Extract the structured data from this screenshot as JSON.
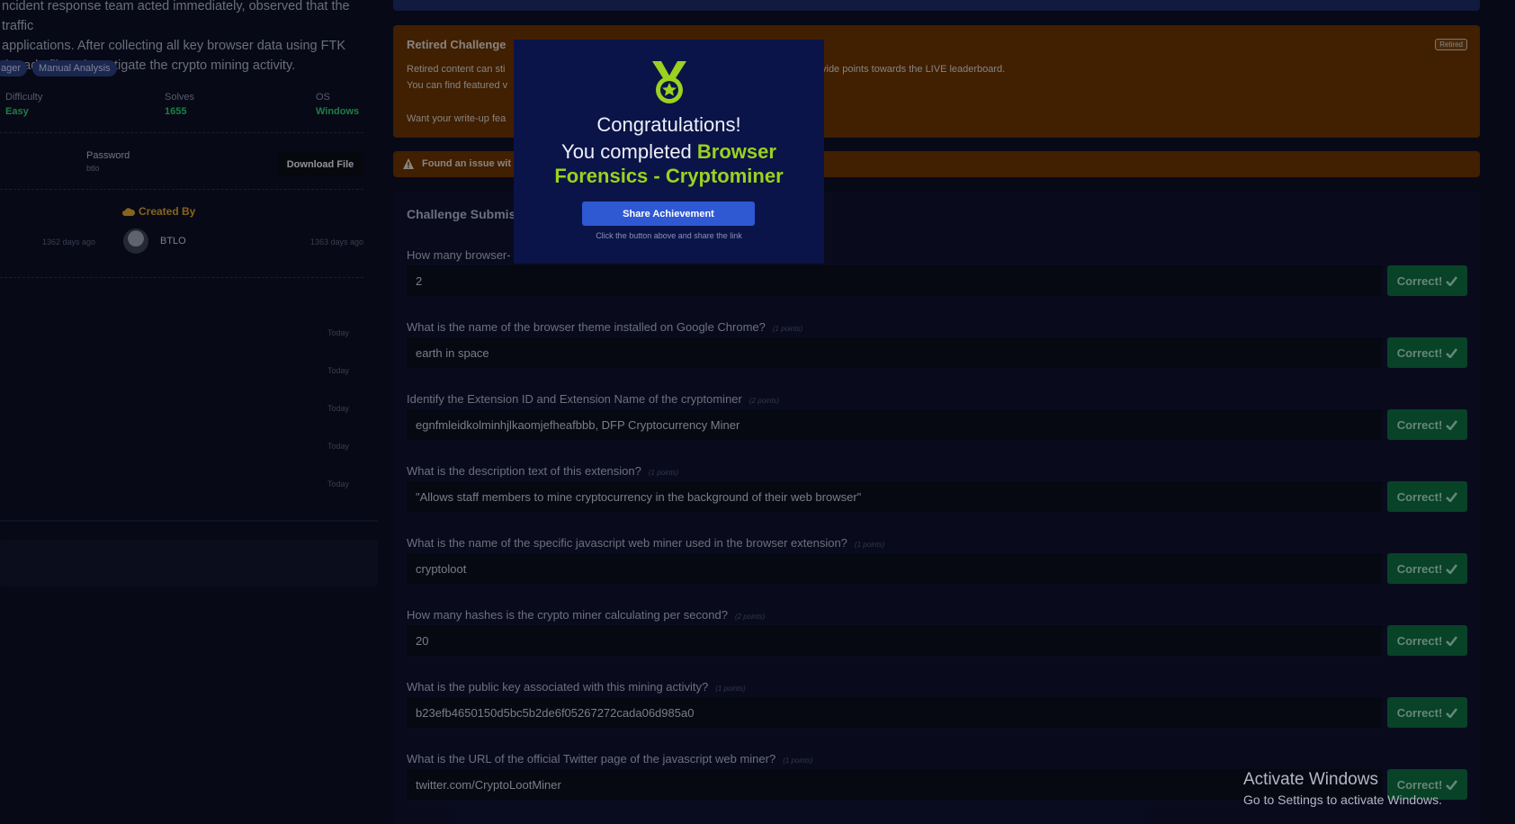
{
  "left": {
    "description_lines": [
      "ncident response team acted immediately, observed that the traffic",
      " applications. After collecting all key browser data using FTK",
      " the ad1 file to investigate the crypto mining activity."
    ],
    "tags": [
      "ager",
      "Manual Analysis"
    ],
    "stats": [
      {
        "label": "Difficulty",
        "value": "Easy"
      },
      {
        "label": "Solves",
        "value": "1655"
      },
      {
        "label": "OS",
        "value": "Windows"
      }
    ],
    "password_label": "Password",
    "password_value": "btlo",
    "download_label": "Download File",
    "created_by_label": "Created By",
    "created_left_ago": "1362 days ago",
    "author": "BTLO",
    "created_right_ago": "1363 days ago",
    "today_labels": [
      "Today",
      "Today",
      "Today",
      "Today",
      "Today"
    ]
  },
  "retired": {
    "title": "Retired Challenge",
    "badge": "Retired",
    "line1_left": "Retired content can sti",
    "line1_right": "vide points towards the LIVE leaderboard.",
    "line2": "You can find featured v",
    "line3": "Want your write-up fea"
  },
  "issue": {
    "text": "Found an issue wit"
  },
  "submission": {
    "title": "Challenge Submis",
    "questions": [
      {
        "q": "How many browser-",
        "pts": "",
        "answer": "2"
      },
      {
        "q": "What is the name of the browser theme installed on Google Chrome?",
        "pts": "(1 points)",
        "answer": "earth in space"
      },
      {
        "q": "Identify the Extension ID and Extension Name of the cryptominer",
        "pts": "(2 points)",
        "answer": "egnfmleidkolminhjlkaomjefheafbbb,  DFP Cryptocurrency Miner"
      },
      {
        "q": "What is the description text of this extension?",
        "pts": "(1 points)",
        "answer": "\"Allows staff members to mine cryptocurrency in the background of their web browser\""
      },
      {
        "q": "What is the name of the specific javascript web miner used in the browser extension?",
        "pts": "(1 points)",
        "answer": "cryptoloot"
      },
      {
        "q": "How many hashes is the crypto miner calculating per second?",
        "pts": "(2 points)",
        "answer": "20"
      },
      {
        "q": "What is the public key associated with this mining activity?",
        "pts": "(1 points)",
        "answer": "b23efb4650150d5bc5b2de6f05267272cada06d985a0"
      },
      {
        "q": "What is the URL of the official Twitter page of the javascript web miner?",
        "pts": "(1 points)",
        "answer": "twitter.com/CryptoLootMiner"
      }
    ],
    "correct_label": "Correct!"
  },
  "modal": {
    "congrats": "Congratulations!",
    "completed_prefix": "You completed ",
    "challenge_name_1": "Browser",
    "challenge_name_2": "Forensics - Cryptominer",
    "share_button": "Share Achievement",
    "share_hint": "Click the button above and share the link"
  },
  "windows": {
    "activate_title": "Activate Windows",
    "activate_sub": "Go to Settings to activate Windows."
  },
  "colors": {
    "accent_green": "#9ad21f",
    "correct_bg": "#0d6b3f",
    "retired_bg": "#6a3303",
    "share_blue": "#2f58d3"
  }
}
